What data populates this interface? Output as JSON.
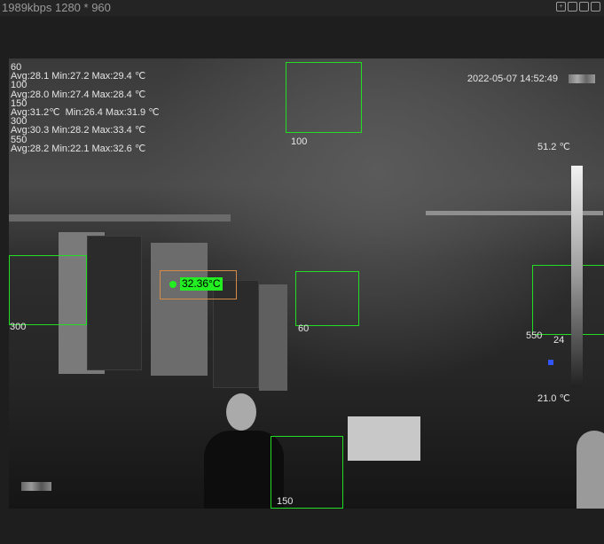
{
  "topbar": {
    "bitrate": "1989kbps  1280 * 960"
  },
  "osd": {
    "lines": "60\nAvg:28.1 Min:27.2 Max:29.4 ℃\n100\nAvg:28.0 Min:27.4 Max:28.4 ℃\n150\nAvg:31.2℃  Min:26.4 Max:31.9 ℃\n300\nAvg:30.3 Min:28.2 Max:33.4 ℃\n550\nAvg:28.2 Min:22.1 Max:32.6 ℃",
    "timestamp": "2022-05-07 14:52:49"
  },
  "scale": {
    "max": "51.2 ℃",
    "min": "21.0 ℃"
  },
  "spot": {
    "value": "32.36°C"
  },
  "rois": [
    {
      "label": "100"
    },
    {
      "label": "300"
    },
    {
      "label": "60"
    },
    {
      "label": "550"
    },
    {
      "label": "150"
    }
  ],
  "partial_label": "24"
}
